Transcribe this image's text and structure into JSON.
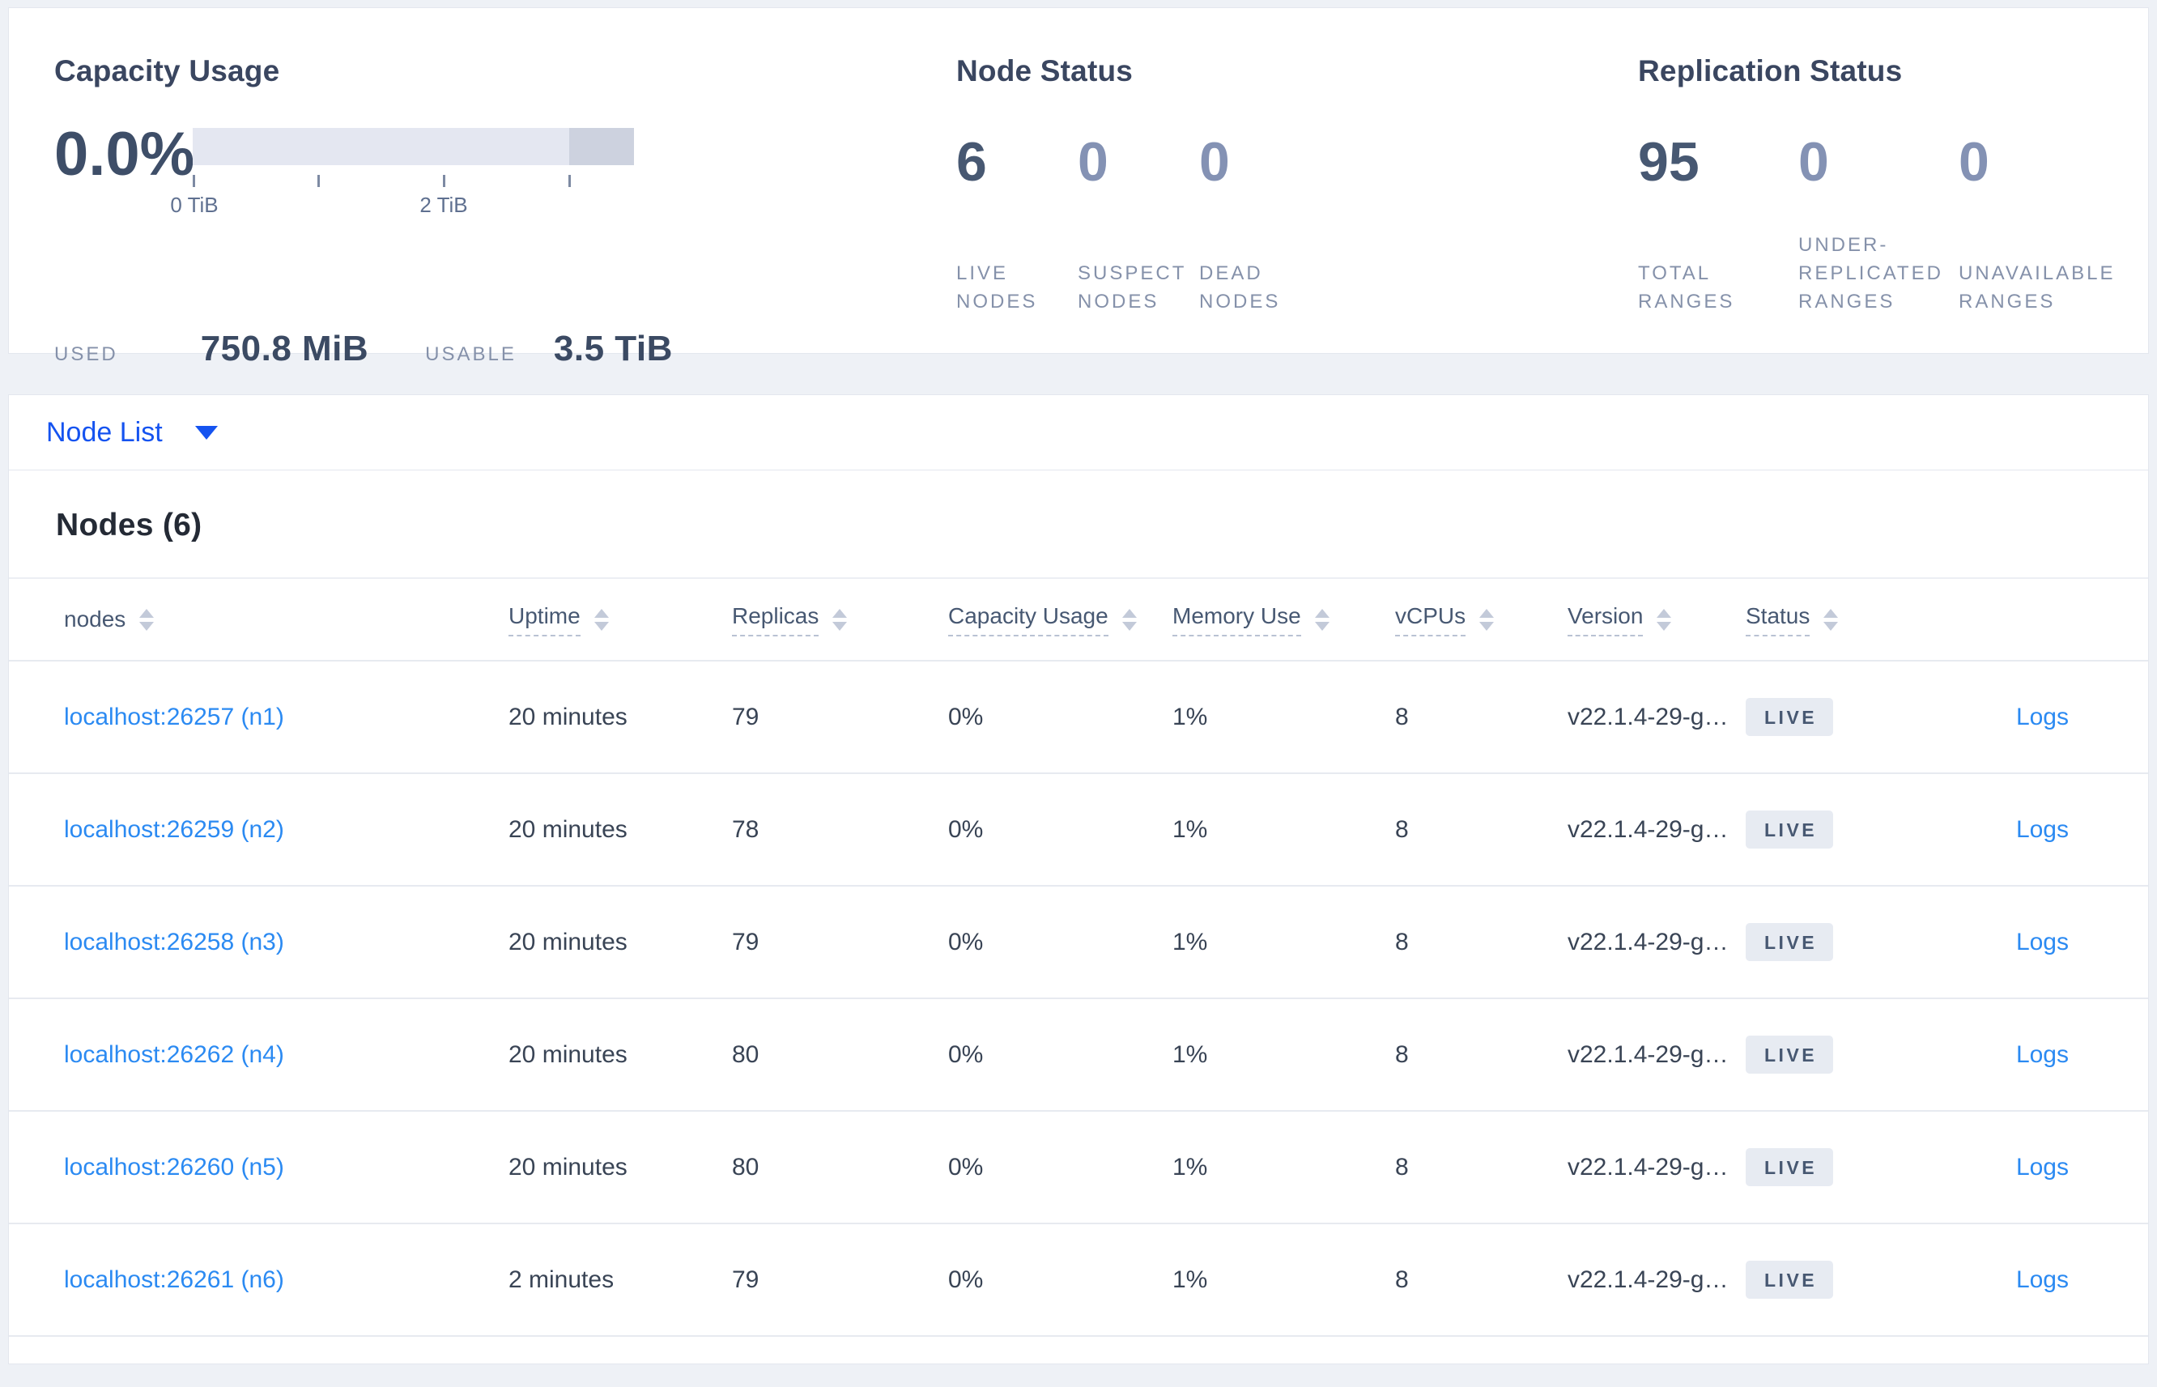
{
  "summary": {
    "capacity": {
      "title": "Capacity Usage",
      "percent": "0.0%",
      "tick_labels": [
        "0 TiB",
        "2 TiB"
      ],
      "used_label": "USED",
      "used_value": "750.8 MiB",
      "usable_label": "USABLE",
      "usable_value": "3.5 TiB"
    },
    "node_status": {
      "title": "Node Status",
      "stats": [
        {
          "value": "6",
          "label": "LIVE NODES"
        },
        {
          "value": "0",
          "label": "SUSPECT NODES"
        },
        {
          "value": "0",
          "label": "DEAD NODES"
        }
      ]
    },
    "replication": {
      "title": "Replication Status",
      "stats": [
        {
          "value": "95",
          "label": "TOTAL RANGES"
        },
        {
          "value": "0",
          "label": "UNDER-REPLICATED RANGES"
        },
        {
          "value": "0",
          "label": "UNAVAILABLE RANGES"
        }
      ]
    }
  },
  "view_selector": {
    "label": "Node List"
  },
  "nodes_section": {
    "title": "Nodes (6)",
    "columns": [
      {
        "label": "nodes"
      },
      {
        "label": "Uptime"
      },
      {
        "label": "Replicas"
      },
      {
        "label": "Capacity Usage"
      },
      {
        "label": "Memory Use"
      },
      {
        "label": "vCPUs"
      },
      {
        "label": "Version"
      },
      {
        "label": "Status"
      }
    ],
    "rows": [
      {
        "node": "localhost:26257 (n1)",
        "uptime": "20 minutes",
        "replicas": "79",
        "capacity": "0%",
        "memory": "1%",
        "vcpus": "8",
        "version": "v22.1.4-29-g…",
        "status": "LIVE",
        "logs": "Logs"
      },
      {
        "node": "localhost:26259 (n2)",
        "uptime": "20 minutes",
        "replicas": "78",
        "capacity": "0%",
        "memory": "1%",
        "vcpus": "8",
        "version": "v22.1.4-29-g…",
        "status": "LIVE",
        "logs": "Logs"
      },
      {
        "node": "localhost:26258 (n3)",
        "uptime": "20 minutes",
        "replicas": "79",
        "capacity": "0%",
        "memory": "1%",
        "vcpus": "8",
        "version": "v22.1.4-29-g…",
        "status": "LIVE",
        "logs": "Logs"
      },
      {
        "node": "localhost:26262 (n4)",
        "uptime": "20 minutes",
        "replicas": "80",
        "capacity": "0%",
        "memory": "1%",
        "vcpus": "8",
        "version": "v22.1.4-29-g…",
        "status": "LIVE",
        "logs": "Logs"
      },
      {
        "node": "localhost:26260 (n5)",
        "uptime": "20 minutes",
        "replicas": "80",
        "capacity": "0%",
        "memory": "1%",
        "vcpus": "8",
        "version": "v22.1.4-29-g…",
        "status": "LIVE",
        "logs": "Logs"
      },
      {
        "node": "localhost:26261 (n6)",
        "uptime": "2 minutes",
        "replicas": "79",
        "capacity": "0%",
        "memory": "1%",
        "vcpus": "8",
        "version": "v22.1.4-29-g…",
        "status": "LIVE",
        "logs": "Logs"
      }
    ]
  },
  "colors": {
    "accent_blue": "#1553f0",
    "link_blue": "#2b8af2",
    "stat_dark": "#475872",
    "stat_dim": "#8492b4",
    "badge_bg": "#e7ebf2"
  }
}
